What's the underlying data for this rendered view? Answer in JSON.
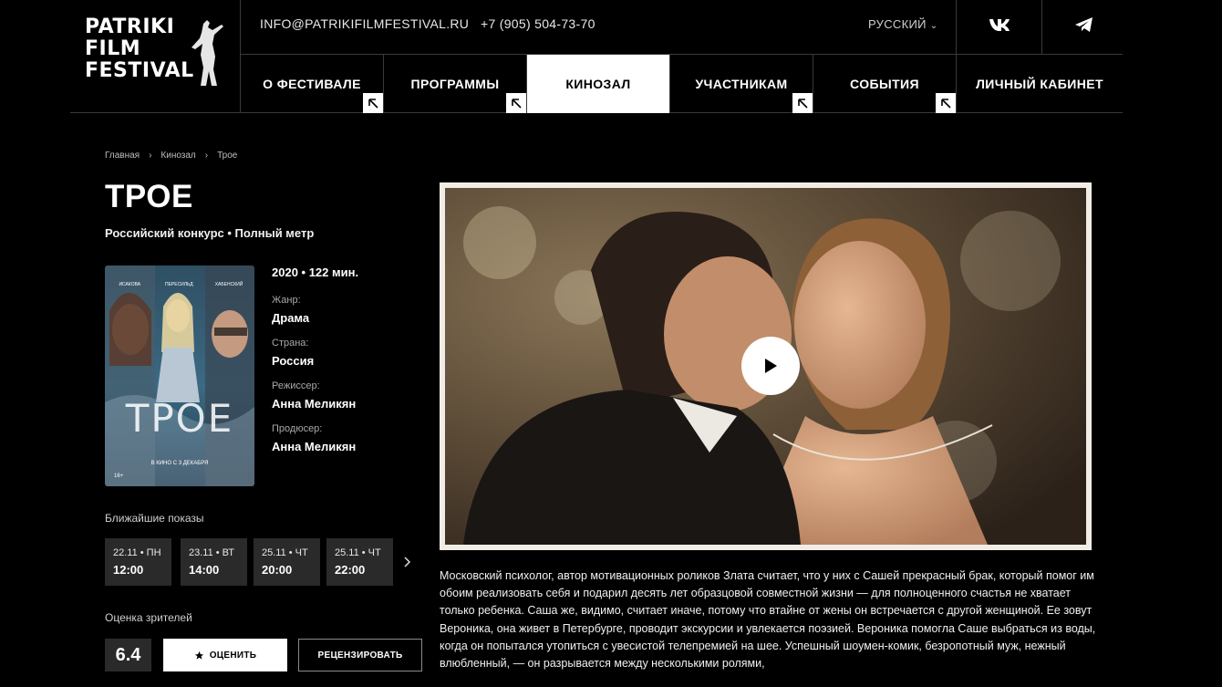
{
  "logo": {
    "lines": [
      "PATRIKI",
      "FILM",
      "FESTIVAL"
    ]
  },
  "header": {
    "email": "INFO@PATRIKIFILMFESTIVAL.RU",
    "phone": "+7 (905) 504-73-70",
    "language": "РУССКИЙ",
    "social": [
      "vk-icon",
      "telegram-icon"
    ]
  },
  "nav": [
    {
      "label": "О ФЕСТИВАЛЕ",
      "active": false,
      "corner": true
    },
    {
      "label": "ПРОГРАММЫ",
      "active": false,
      "corner": true
    },
    {
      "label": "КИНОЗАЛ",
      "active": true,
      "corner": false
    },
    {
      "label": "УЧАСТНИКАМ",
      "active": false,
      "corner": true
    },
    {
      "label": "СОБЫТИЯ",
      "active": false,
      "corner": true
    },
    {
      "label": "ЛИЧНЫЙ КАБИНЕТ",
      "active": false,
      "corner": false
    }
  ],
  "breadcrumbs": [
    "Главная",
    "Кинозал",
    "Трое"
  ],
  "film": {
    "title": "ТРОЕ",
    "subtitle": "Российский конкурс • Полный метр",
    "year_length": "2020 • 122 мин.",
    "details": [
      {
        "label": "Жанр:",
        "value": "Драма"
      },
      {
        "label": "Страна:",
        "value": "Россия"
      },
      {
        "label": "Режиссер:",
        "value": "Анна Меликян"
      },
      {
        "label": "Продюсер:",
        "value": "Анна Меликян"
      }
    ],
    "poster": {
      "top_names": [
        "ИСАКОВА",
        "ПЕРЕСИЛЬД",
        "ХАБЕНСКИЙ"
      ],
      "title": "ТРОЕ",
      "release": "В КИНО С 3 ДЕКАБРЯ",
      "age": "16+"
    }
  },
  "screenings": {
    "label": "Ближайшие показы",
    "items": [
      {
        "date": "22.11 • ПН",
        "time": "12:00"
      },
      {
        "date": "23.11 • ВТ",
        "time": "14:00"
      },
      {
        "date": "25.11 • ЧТ",
        "time": "20:00"
      },
      {
        "date": "25.11 • ЧТ",
        "time": "22:00"
      }
    ]
  },
  "rating": {
    "label": "Оценка зрителей",
    "value": "6.4",
    "rate_button": "ОЦЕНИТЬ",
    "review_button": "РЕЦЕНЗИРОВАТЬ"
  },
  "description": "Московский психолог, автор мотивационных роликов Злата считает, что у них с Сашей прекрасный брак, который помог им обоим реализовать себя и подарил десять лет образцовой совместной жизни — для полноценного счастья не хватает только ребенка. Саша же, видимо, считает иначе, потому что втайне от жены он встречается с другой женщиной. Ее зовут Вероника, она живет в Петербурге, проводит экскурсии и увлекается поэзией. Вероника помогла Саше выбраться из воды, когда он попытался утопиться с увесистой телепремией на шее. Успешный шоумен-комик, безропотный муж, нежный влюбленный, — он разрывается между несколькими ролями,"
}
